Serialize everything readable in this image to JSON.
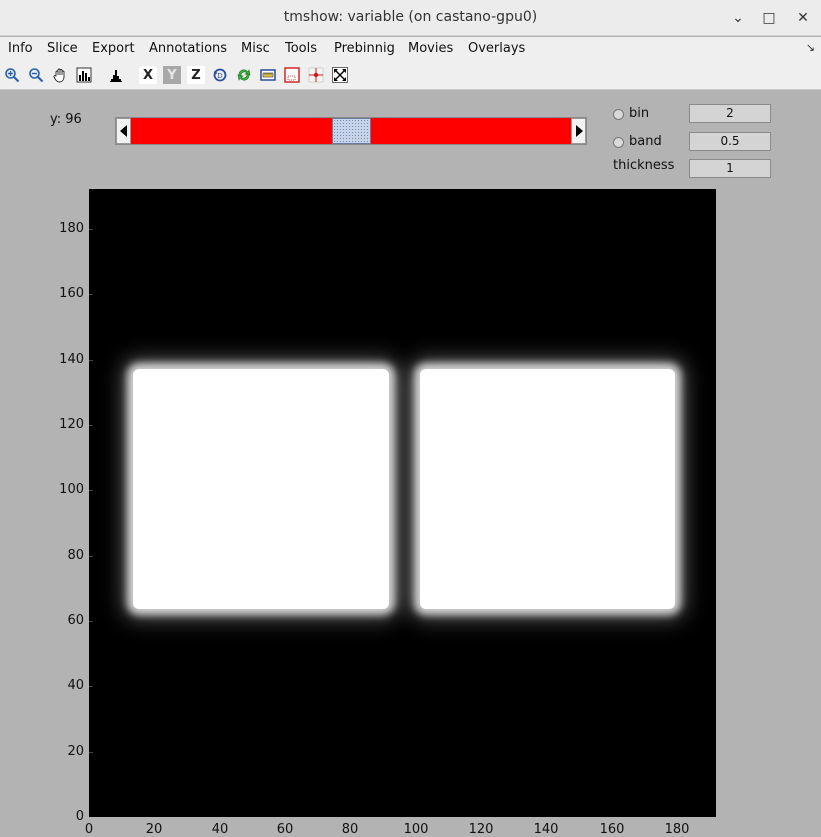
{
  "window": {
    "title": "tmshow: variable (on castano-gpu0)",
    "minimize_glyph": "⌄",
    "maximize_glyph": "□",
    "close_glyph": "✕"
  },
  "menu": {
    "items": [
      "Info",
      "Slice",
      "Export",
      "Annotations",
      "Misc",
      "Tools",
      "Prebinnig",
      "Movies",
      "Overlays"
    ],
    "corner_glyph": "↘"
  },
  "toolbar": {
    "x_label": "X",
    "y_label": "Y",
    "z_label": "Z"
  },
  "slice_control": {
    "axis_label": "y: 96",
    "slider_value": 96,
    "slider_min": 0,
    "slider_max": 192,
    "track_color": "#ff0000"
  },
  "options": {
    "bin_label": "bin",
    "bin_value": "2",
    "band_label": "band",
    "band_value": "0.5",
    "thickness_label": "thickness",
    "thickness_value": "1"
  },
  "plot": {
    "x_ticks": [
      "0",
      "20",
      "40",
      "60",
      "80",
      "100",
      "120",
      "140",
      "160",
      "180"
    ],
    "y_ticks": [
      "180",
      "160",
      "140",
      "120",
      "100",
      "80",
      "60",
      "40",
      "20",
      "0"
    ],
    "background_color": "#000000",
    "blob_color": "#ffffff"
  }
}
